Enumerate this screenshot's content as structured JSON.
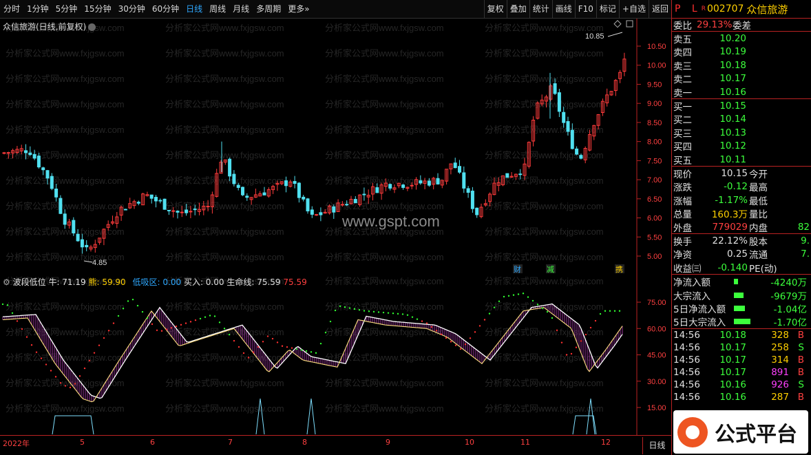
{
  "toolbar": {
    "periods": [
      "分时",
      "1分钟",
      "5分钟",
      "15分钟",
      "30分钟",
      "60分钟",
      "日线",
      "周线",
      "月线",
      "多周期",
      "更多»"
    ],
    "active": "日线",
    "right": [
      "复权",
      "叠加",
      "统计",
      "画线",
      "F10",
      "标记",
      "+自选",
      "返回"
    ]
  },
  "chart": {
    "title": "众信旅游(日线,前复权)",
    "price_ticks": [
      "10.50",
      "10.00",
      "9.50",
      "9.00",
      "8.50",
      "8.00",
      "7.50",
      "7.00",
      "6.50",
      "6.00",
      "5.50",
      "5.00"
    ],
    "high_label": "10.85",
    "low_label": "4.85",
    "watermark": "www.gspt.com",
    "wm_text": "分析家公式网www.fxjgsw.com",
    "badges": [
      "财",
      "减",
      "携"
    ]
  },
  "indicator": {
    "name": "波段低位",
    "niu": "牛: 71.19",
    "xiong": "熊: 59.90",
    "dixi_label": "低吸区:",
    "dixi": "0.00",
    "mairu": "买入: 0.00",
    "shengming": "生命线: 75.59",
    "last": "75.59",
    "ticks": [
      "75.00",
      "60.00",
      "45.00",
      "30.00",
      "15.00"
    ]
  },
  "footer": {
    "dates": [
      "2022年",
      "5",
      "6",
      "7",
      "8",
      "9",
      "10",
      "11",
      "12"
    ],
    "period": "日线"
  },
  "quote": {
    "code": "002707",
    "name": "众信旅游",
    "pl": "P L",
    "r": "R",
    "weibi_label": "委比",
    "weibi": "29.13%",
    "weicha": "委差",
    "sell": [
      {
        "l": "卖五",
        "p": "10.20"
      },
      {
        "l": "卖四",
        "p": "10.19"
      },
      {
        "l": "卖三",
        "p": "10.18"
      },
      {
        "l": "卖二",
        "p": "10.17"
      },
      {
        "l": "卖一",
        "p": "10.16"
      }
    ],
    "buy": [
      {
        "l": "买一",
        "p": "10.15"
      },
      {
        "l": "买二",
        "p": "10.14"
      },
      {
        "l": "买三",
        "p": "10.13"
      },
      {
        "l": "买四",
        "p": "10.12"
      },
      {
        "l": "买五",
        "p": "10.11"
      }
    ],
    "stats": [
      {
        "l": "现价",
        "v": "10.15",
        "r": "今开"
      },
      {
        "l": "涨跌",
        "v": "-0.12",
        "r": "最高"
      },
      {
        "l": "涨幅",
        "v": "-1.17%",
        "r": "最低"
      },
      {
        "l": "总量",
        "v": "160.3万",
        "r": "量比"
      },
      {
        "l": "外盘",
        "v": "779029",
        "r": "内盘",
        "rv": "82"
      }
    ],
    "stats2": [
      {
        "l": "换手",
        "v": "22.12%",
        "r": "股本",
        "rv": "9."
      },
      {
        "l": "净资",
        "v": "0.25",
        "r": "流通",
        "rv": "7."
      },
      {
        "l": "收益㈢",
        "v": "-0.140",
        "r": "PE(动)"
      }
    ],
    "flow": [
      {
        "l": "净流入额",
        "v": "-4240万"
      },
      {
        "l": "大宗流入",
        "v": "-9679万"
      },
      {
        "l": "5日净流入额",
        "v": "-1.04亿"
      },
      {
        "l": "5日大宗流入",
        "v": "-1.70亿"
      }
    ],
    "ticks": [
      {
        "t": "14:56",
        "p": "10.18",
        "v": "328",
        "s": "B"
      },
      {
        "t": "14:56",
        "p": "10.17",
        "v": "258",
        "s": "S"
      },
      {
        "t": "14:56",
        "p": "10.17",
        "v": "314",
        "s": "B"
      },
      {
        "t": "14:56",
        "p": "10.17",
        "v": "891",
        "s": "B"
      },
      {
        "t": "14:56",
        "p": "10.16",
        "v": "926",
        "s": "S"
      },
      {
        "t": "14:56",
        "p": "10.16",
        "v": "287",
        "s": "B"
      }
    ]
  },
  "logo": {
    "text": "公式平台"
  },
  "colors": {
    "up": "#ff3b3b",
    "down": "#50e0f0",
    "border": "#b22222"
  }
}
